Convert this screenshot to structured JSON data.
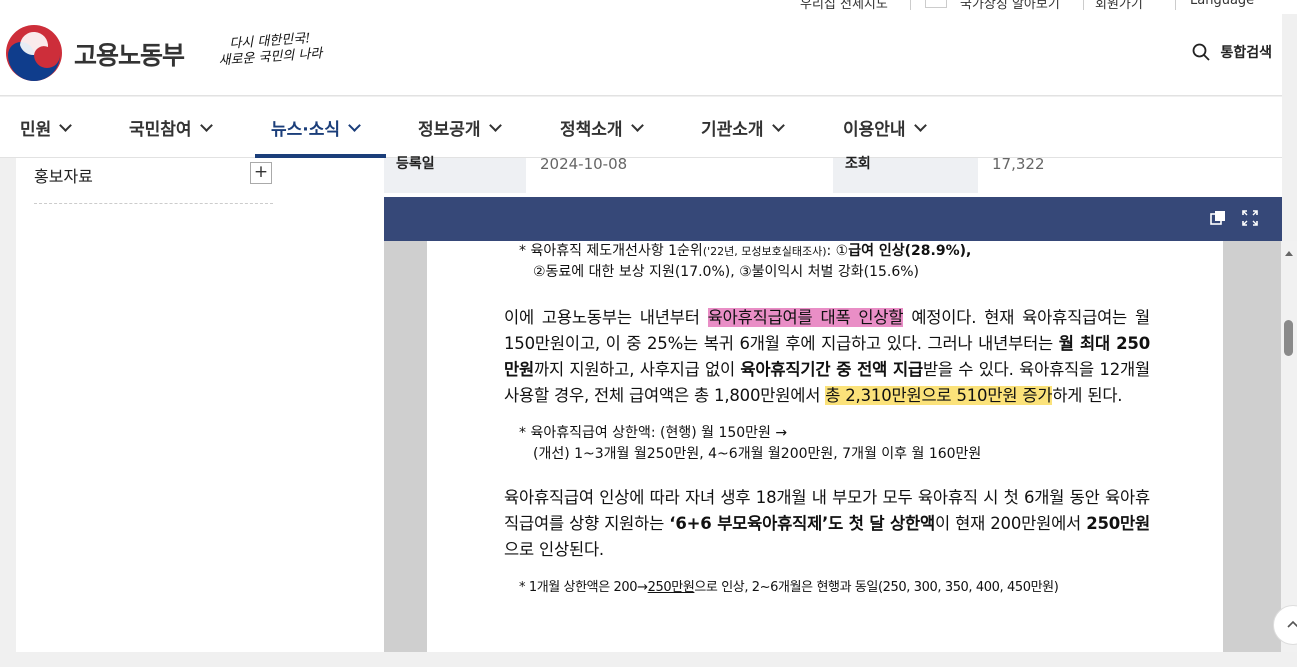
{
  "utility": {
    "items": [
      "우리집 전세지도",
      "국가상징 알아보기",
      "회원가기",
      "Language"
    ]
  },
  "header": {
    "logo_text": "고용노동부",
    "slogan_line1": "다시 대한민국!",
    "slogan_line2": "새로운 국민의 나라",
    "search_label": "통합검색"
  },
  "gnb": {
    "items": [
      {
        "label": "민원"
      },
      {
        "label": "국민참여"
      },
      {
        "label": "뉴스·소식"
      },
      {
        "label": "정보공개"
      },
      {
        "label": "정책소개"
      },
      {
        "label": "기관소개"
      },
      {
        "label": "이용안내"
      }
    ]
  },
  "sidebar": {
    "item_label": "홍보자료",
    "expand_symbol": "+"
  },
  "info": {
    "date_label": "등록일",
    "date_value": "2024-10-08",
    "views_label": "조회",
    "views_value": "17,322"
  },
  "doc": {
    "note1_a": "* 육아휴직 제도개선사항 1순위",
    "note1_small": "('22년, 모성보호실태조사)",
    "note1_b": ": ①",
    "note1_bold": "급여 인상(28.9%),",
    "note1_line2": "②동료에 대한 보상 지원(17.0%), ③불이익시 처벌 강화(15.6%)",
    "p1_a": " 이에 고용노동부는 내년부터 ",
    "p1_hl": "육아휴직급여를 대폭 인상할",
    "p1_b": " 예정이다. 현재 육아휴직급여는 월 150만원이고, 이 중 25%는 복귀 6개월 후에 지급하고 있다. 그러나 내년부터는 ",
    "p1_bold1": "월 최대 250만원",
    "p1_c": "까지 지원하고, 사후지급 없이 ",
    "p1_bold2": "육아휴직기간 중 전액 지급",
    "p1_d": "받을 수 있다. 육아휴직을 12개월 사용할 경우, 전체 급여액은 총 1,800만원에서 ",
    "p1_hl2": "총 2,310만원으로 510만원 증가",
    "p1_e": "하게 된다.",
    "note2_line1": "* 육아휴직급여 상한액: (현행) 월 150만원 →",
    "note2_line2": "(개선) 1~3개월 월250만원, 4~6개월 월200만원, 7개월 이후 월 160만원",
    "p2_a": " 육아휴직급여 인상에 따라 자녀 생후 18개월 내 부모가 모두 육아휴직 시 첫 6개월 동안 육아휴직급여를 상향 지원하는 ",
    "p2_bold1": "‘6+6 부모육아휴직제’도 첫 달 상한액",
    "p2_b": "이 현재 200만원에서 ",
    "p2_bold2": "250만원",
    "p2_c": "으로 인상된다.",
    "note3_a": "* 1개월 상한액은 200→",
    "note3_u": "250만원",
    "note3_b": "으로 인상, 2~6개월은 현행과 동일(250, 300, 350, 400, 450만원)"
  },
  "colors": {
    "accent": "#1b3e7a",
    "viewer_bar": "#364878",
    "highlight_pink": "#e98ec6",
    "highlight_yellow": "#fbe27a"
  }
}
